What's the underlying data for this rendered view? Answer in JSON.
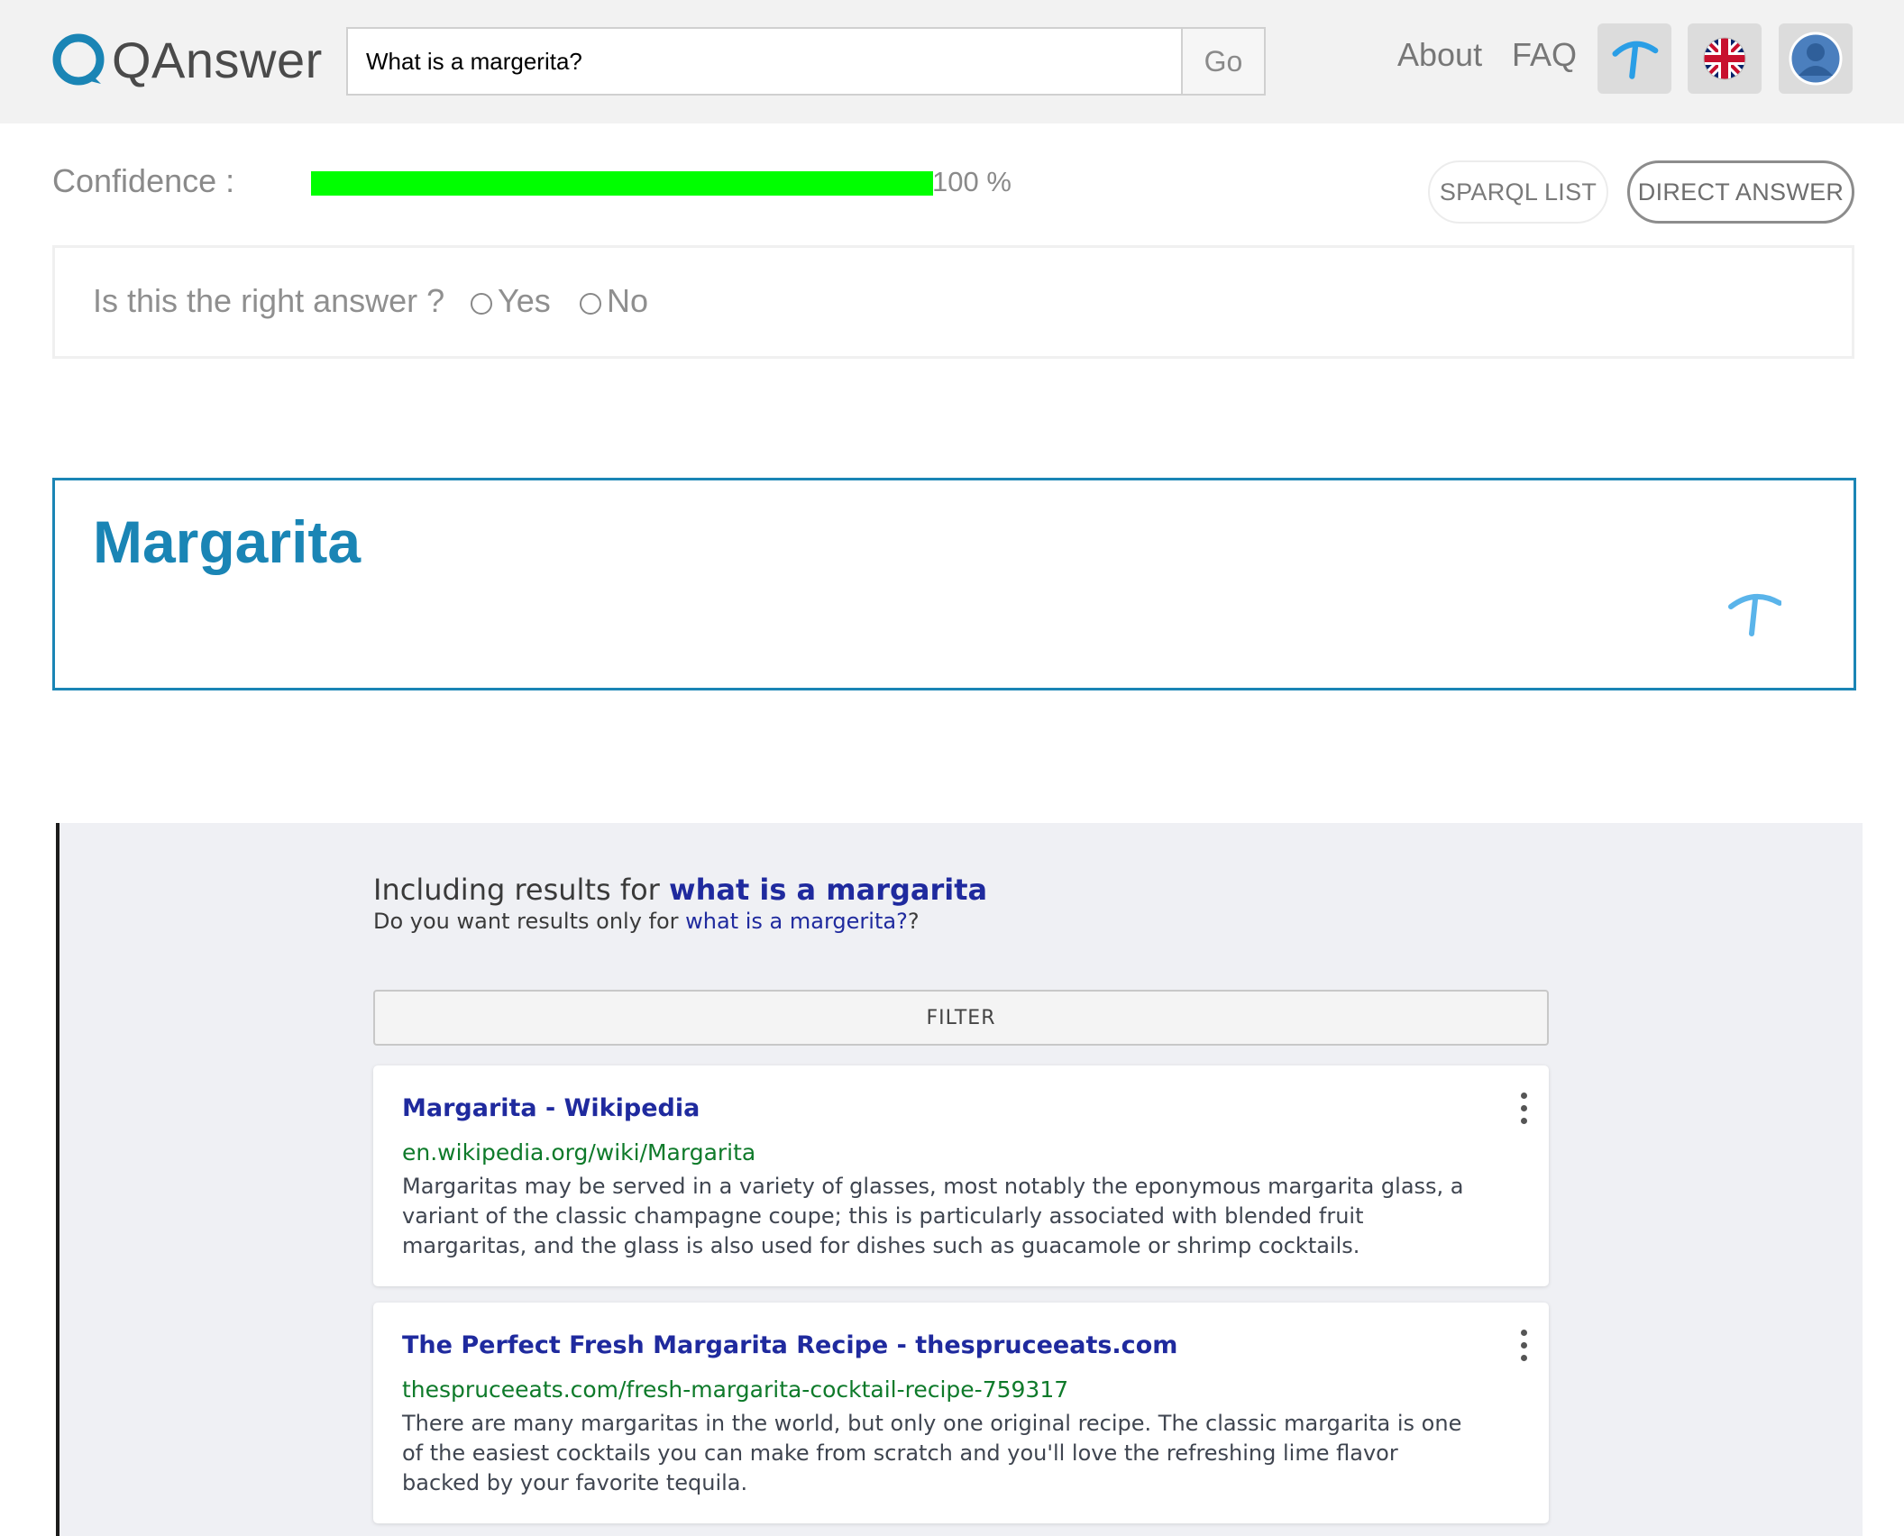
{
  "header": {
    "logo_text": "QAnswer",
    "search": {
      "value": "What is a margerita?",
      "placeholder": ""
    },
    "go_label": "Go",
    "nav": {
      "about": "About",
      "faq": "FAQ"
    },
    "icons": [
      "dataset-pickaxe-icon",
      "uk-flag-icon",
      "user-avatar-icon"
    ]
  },
  "confidence": {
    "label": "Confidence :",
    "value_text": "100 %",
    "value": 100
  },
  "buttons": {
    "sparql_list": "SPARQL LIST",
    "direct_answer": "DIRECT ANSWER"
  },
  "feedback": {
    "question": "Is this the right answer ?",
    "yes": "Yes",
    "no": "No"
  },
  "answer": {
    "title": "Margarita"
  },
  "results": {
    "including_prefix": "Including results for ",
    "including_query": "what is a margarita",
    "want_prefix": "Do you want results only for ",
    "want_query": "what is a margerita?",
    "want_suffix": "?",
    "filter_label": "FILTER",
    "items": [
      {
        "title": "Margarita - Wikipedia",
        "url": "en.wikipedia.org/wiki/Margarita",
        "snippet": "Margaritas may be served in a variety of glasses, most notably the eponymous margarita glass, a variant of the classic champagne coupe; this is particularly associated with blended fruit margaritas, and the glass is also used for dishes such as guacamole or shrimp cocktails."
      },
      {
        "title": "The Perfect Fresh Margarita Recipe - thespruceeats.com",
        "url": "thespruceeats.com/fresh-margarita-cocktail-recipe-759317",
        "snippet": "There are many margaritas in the world, but only one original recipe. The classic margarita is one of the easiest cocktails you can make from scratch and you'll love the refreshing lime flavor backed by your favorite tequila."
      }
    ]
  },
  "colors": {
    "accent": "#1a85b5",
    "confidence_bar": "#00ff00",
    "result_title": "#1f2a9e",
    "result_url": "#0e7a2a"
  }
}
